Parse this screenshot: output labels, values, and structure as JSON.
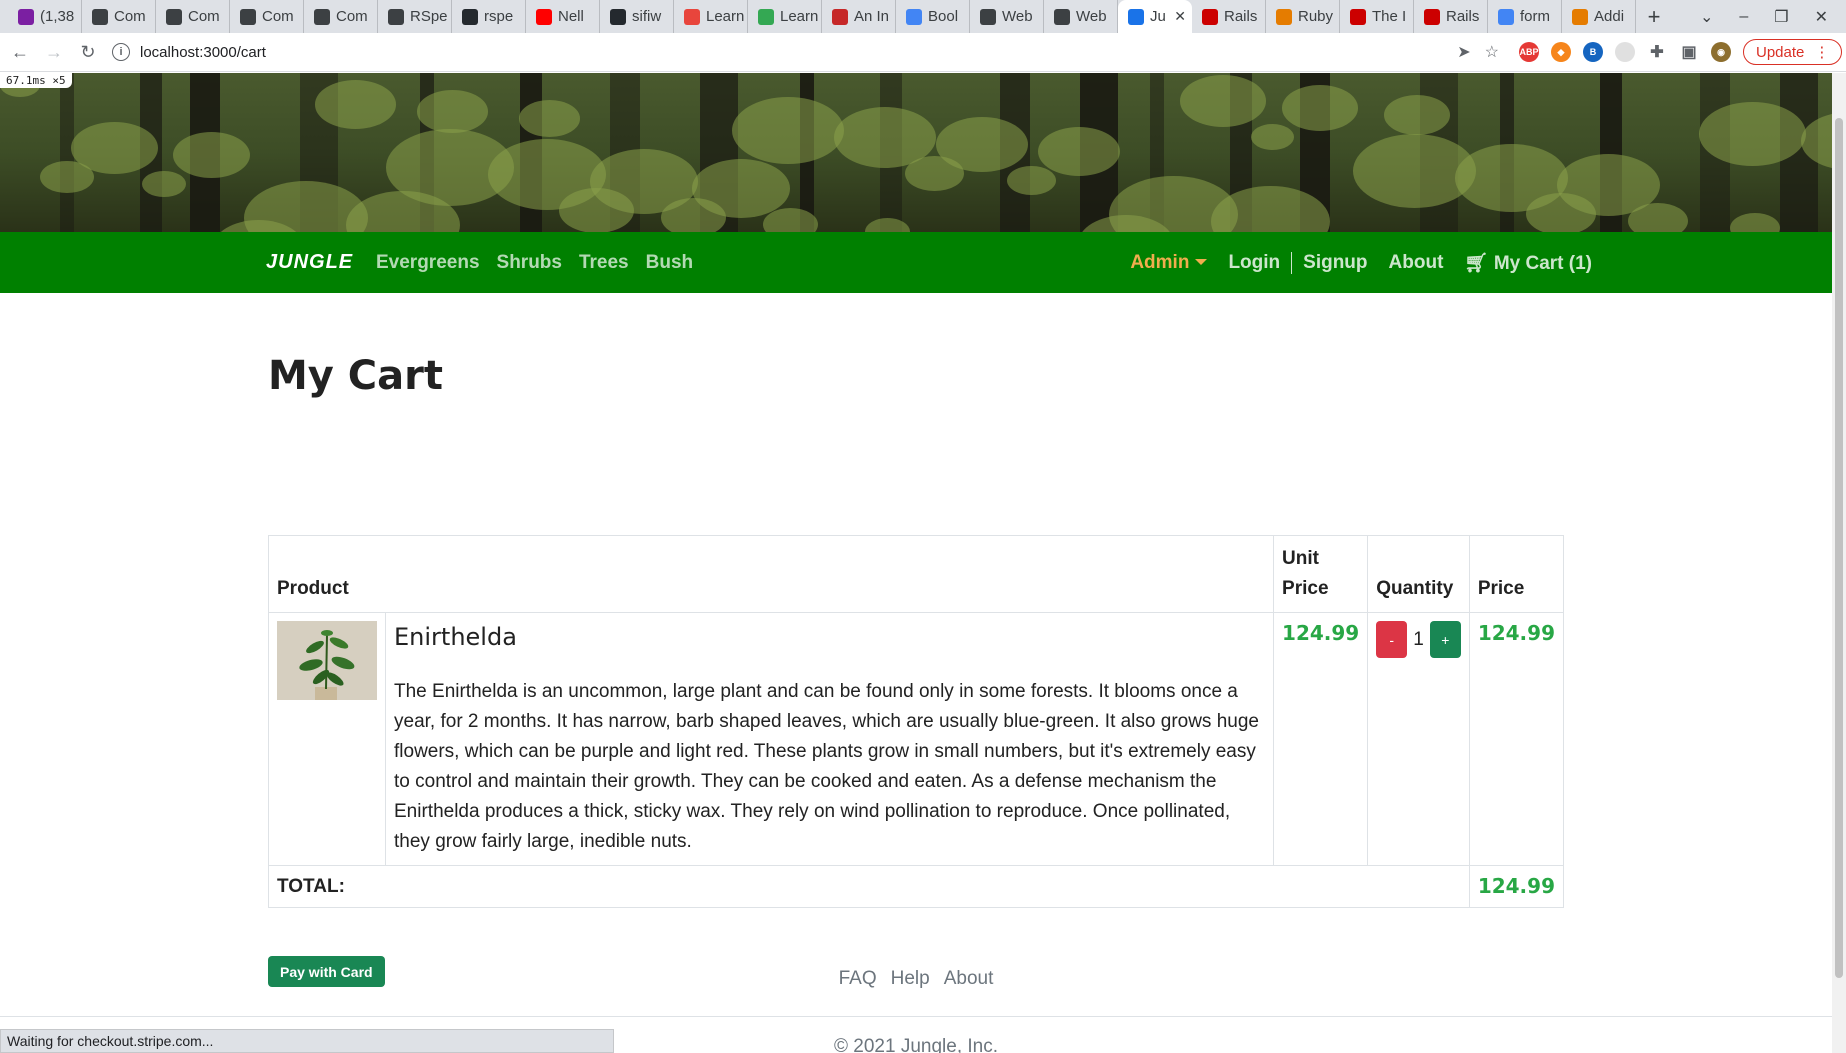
{
  "browser": {
    "tabs": [
      {
        "label": "(1,38",
        "color": "#7b1fa2"
      },
      {
        "label": "Com",
        "color": "#3c4043"
      },
      {
        "label": "Com",
        "color": "#3c4043"
      },
      {
        "label": "Com",
        "color": "#3c4043"
      },
      {
        "label": "Com",
        "color": "#3c4043"
      },
      {
        "label": "RSpe",
        "color": "#3c4043"
      },
      {
        "label": "rspe",
        "color": "#24292e"
      },
      {
        "label": "Nell",
        "color": "#ff0000"
      },
      {
        "label": "sifiw",
        "color": "#24292e"
      },
      {
        "label": "Learn",
        "color": "#e8453c"
      },
      {
        "label": "Learn",
        "color": "#34a853"
      },
      {
        "label": "An In",
        "color": "#c62828"
      },
      {
        "label": "Bool",
        "color": "#4285f4"
      },
      {
        "label": "Web",
        "color": "#3c4043"
      },
      {
        "label": "Web",
        "color": "#3c4043"
      },
      {
        "label": "Ju",
        "color": "#1a73e8",
        "active": true
      },
      {
        "label": "Rails",
        "color": "#cc0000"
      },
      {
        "label": "Ruby",
        "color": "#e57c00"
      },
      {
        "label": "The I",
        "color": "#cc0000"
      },
      {
        "label": "Rails",
        "color": "#cc0000"
      },
      {
        "label": "form",
        "color": "#4285f4"
      },
      {
        "label": "Addi",
        "color": "#e57c00"
      }
    ],
    "url": "localhost:3000/cart",
    "update_label": "Update",
    "perf_overlay": "67.1ms ×5",
    "status_text": "Waiting for checkout.stripe.com..."
  },
  "navbar": {
    "brand": "JUNGLE",
    "left_links": [
      "Evergreens",
      "Shrubs",
      "Trees",
      "Bush"
    ],
    "admin_label": "Admin",
    "login_label": "Login",
    "signup_label": "Signup",
    "about_label": "About",
    "cart_label": "My Cart (1)"
  },
  "main": {
    "title": "My Cart",
    "table": {
      "headers": {
        "product": "Product",
        "unit_price": "Unit Price",
        "quantity": "Quantity",
        "price": "Price"
      },
      "rows": [
        {
          "name": "Enirthelda",
          "description": "The Enirthelda is an uncommon, large plant and can be found only in some forests. It blooms once a year, for 2 months. It has narrow, barb shaped leaves, which are usually blue-green. It also grows huge flowers, which can be purple and light red. These plants grow in small numbers, but it's extremely easy to control and maintain their growth. They can be cooked and eaten. As a defense mechanism the Enirthelda produces a thick, sticky wax. They rely on wind pollination to reproduce. Once pollinated, they grow fairly large, inedible nuts.",
          "unit_price": "124.99",
          "quantity": "1",
          "price": "124.99",
          "minus_label": "-",
          "plus_label": "+"
        }
      ],
      "total_label": "TOTAL:",
      "total_value": "124.99"
    },
    "pay_button": "Pay with Card",
    "accent_color": "#28a745"
  },
  "footer": {
    "links": [
      "FAQ",
      "Help",
      "About"
    ],
    "copyright": "© 2021 Jungle, Inc."
  }
}
